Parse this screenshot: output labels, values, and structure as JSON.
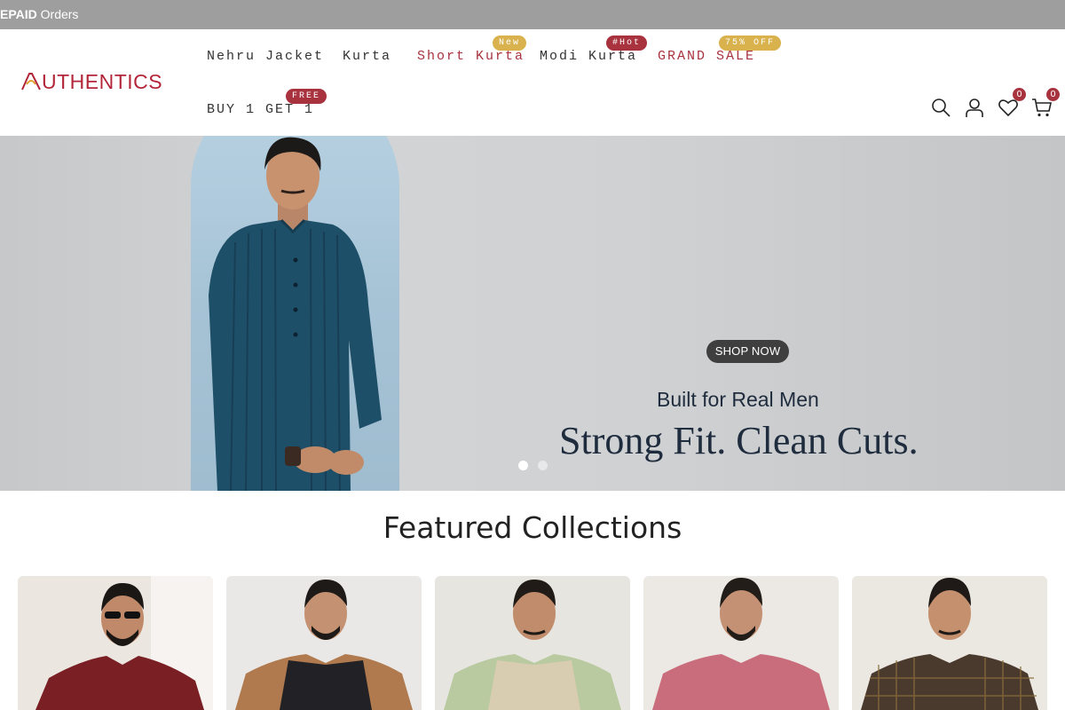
{
  "announcement": {
    "bold": "EPAID",
    "rest": " Orders"
  },
  "header": {
    "logo_text": "UTHENTICS",
    "nav": [
      {
        "label": "Nehru Jacket"
      },
      {
        "label": "Kurta"
      },
      {
        "label": "Short Kurta",
        "badge": "New"
      },
      {
        "label": "Modi Kurta",
        "badge": "#Hot"
      },
      {
        "label": "GRAND SALE",
        "badge": "75% OFF"
      },
      {
        "label": "BUY 1 GET 1",
        "badge": "FREE"
      }
    ],
    "wishlist_count": "0",
    "cart_count": "0"
  },
  "hero": {
    "subtitle": "Built for Real Men",
    "title": "Strong Fit. Clean Cuts.",
    "button": "SHOP NOW",
    "slide_count": 2,
    "active_slide": 1
  },
  "featured": {
    "title": "Featured Collections",
    "cards": [
      {
        "name": "collection-1",
        "color": "#7a1f24"
      },
      {
        "name": "collection-2",
        "color": "#2b2b2f"
      },
      {
        "name": "collection-3",
        "color": "#d9cfb3"
      },
      {
        "name": "collection-4",
        "color": "#c96d7c"
      },
      {
        "name": "collection-5",
        "color": "#4a3a2e"
      }
    ]
  },
  "colors": {
    "brand": "#a8323e",
    "badge_yellow": "#d9b24e"
  }
}
